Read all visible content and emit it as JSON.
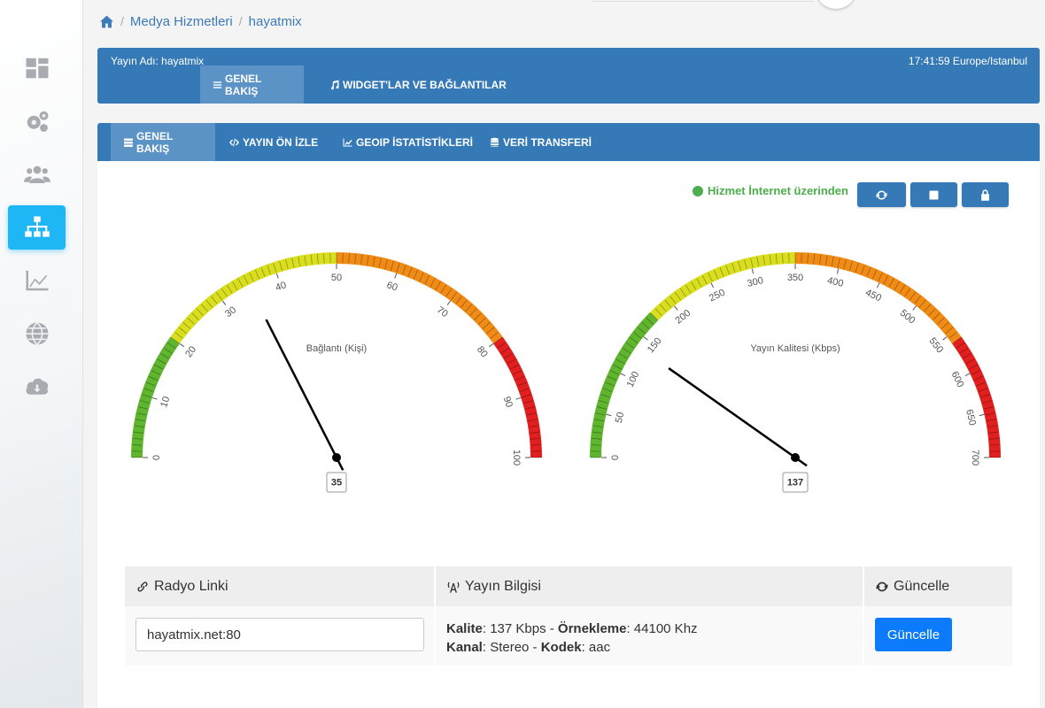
{
  "breadcrumb": {
    "items": [
      "Medya Hizmetleri",
      "hayatmix"
    ]
  },
  "sidebar": {
    "items": [
      {
        "icon": "dashboard-icon"
      },
      {
        "icon": "gears-icon"
      },
      {
        "icon": "users-icon"
      },
      {
        "icon": "sitemap-icon",
        "active": true
      },
      {
        "icon": "area-chart-icon"
      },
      {
        "icon": "globe-icon"
      },
      {
        "icon": "cloud-download-icon"
      }
    ]
  },
  "header": {
    "stream_name": "Yayın Adı: hayatmix",
    "clock": "17:41:59 Europe/Istanbul",
    "tabs": [
      {
        "label": "GENEL BAKIŞ",
        "active": true
      },
      {
        "label": "WIDGET'LAR VE BAĞLANTILAR"
      }
    ]
  },
  "subtabs": [
    {
      "label": "GENEL BAKIŞ",
      "active": true
    },
    {
      "label": "YAYIN ÖN İZLE"
    },
    {
      "label": "GEOIP İSTATİSTİKLERİ"
    },
    {
      "label": "VERİ TRANSFERİ"
    }
  ],
  "status": {
    "text": "Hizmet İnternet üzerinden",
    "color": "#4cae4c"
  },
  "controls": [
    "refresh-icon",
    "stop-icon",
    "lock-icon"
  ],
  "gauges": [
    {
      "title": "Bağlantı (Kişi)",
      "min": 0,
      "max": 100,
      "step": 10,
      "value": 35,
      "value_label": "35",
      "ticks": [
        "0",
        "10",
        "20",
        "30",
        "40",
        "50",
        "60",
        "70",
        "80",
        "90",
        "100"
      ],
      "bands": [
        {
          "from": 0,
          "to": 20,
          "color": "#5fb52e"
        },
        {
          "from": 20,
          "to": 50,
          "color": "#d9df1f"
        },
        {
          "from": 50,
          "to": 80,
          "color": "#f08c16"
        },
        {
          "from": 80,
          "to": 100,
          "color": "#e11f1f"
        }
      ]
    },
    {
      "title": "Yayın Kalitesi (Kbps)",
      "min": 0,
      "max": 700,
      "step": 50,
      "value": 137,
      "value_label": "137",
      "ticks": [
        "0",
        "50",
        "100",
        "150",
        "200",
        "250",
        "300",
        "350",
        "400",
        "450",
        "500",
        "550",
        "600",
        "650",
        "700"
      ],
      "bands": [
        {
          "from": 0,
          "to": 175,
          "color": "#5fb52e"
        },
        {
          "from": 175,
          "to": 350,
          "color": "#d9df1f"
        },
        {
          "from": 350,
          "to": 560,
          "color": "#f08c16"
        },
        {
          "from": 560,
          "to": 700,
          "color": "#e11f1f"
        }
      ]
    }
  ],
  "table": {
    "headers": [
      "Radyo Linki",
      "Yayın Bilgisi",
      "Güncelle"
    ],
    "link_value": "hayatmix.net:80",
    "info": {
      "quality_label": "Kalite",
      "quality_value": ": 137 Kbps - ",
      "sample_label": "Örnekleme",
      "sample_value": ": 44100 Khz",
      "channel_label": "Kanal",
      "channel_value": ": Stereo - ",
      "codec_label": "Kodek",
      "codec_value": ": aac"
    },
    "update_button": "Güncelle"
  }
}
